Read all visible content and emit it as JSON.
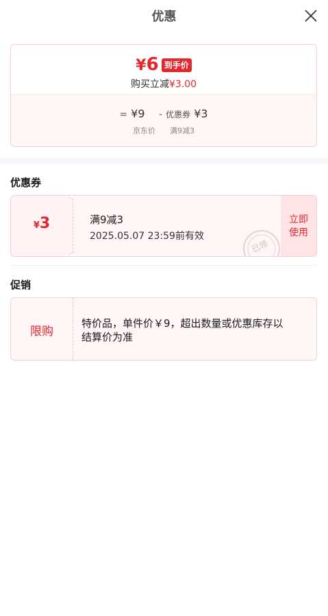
{
  "header": {
    "title": "优惠",
    "close_icon": "close-icon"
  },
  "price_summary": {
    "currency": "¥",
    "final_price": "6",
    "final_badge": "到手价",
    "reduce_text": "购买立减",
    "reduce_amount": "¥3.00",
    "calc": {
      "equals": "=",
      "base_price": "¥9",
      "minus": "-",
      "coupon_label": "优惠券",
      "coupon_amount": "¥3"
    },
    "labels": {
      "base_label": "京东价",
      "coupon_rule": "满9减3"
    }
  },
  "coupon_section": {
    "title": "优惠券",
    "coupon": {
      "currency": "¥",
      "value": "3",
      "name": "满9减3",
      "expiry": "2025.05.07 23:59前有效",
      "stamp_text": "已领",
      "action_label": "立即使用"
    }
  },
  "promo_section": {
    "title": "促销",
    "tag": "限购",
    "text": "特价品，单件价￥9，超出数量或优惠库存以结算价为准"
  },
  "colors": {
    "accent": "#e4262e",
    "card_border": "#f3d0d3",
    "card_bg": "#fff6f7",
    "button_bg": "#ffe4e7",
    "band": "#f5f7fc"
  }
}
